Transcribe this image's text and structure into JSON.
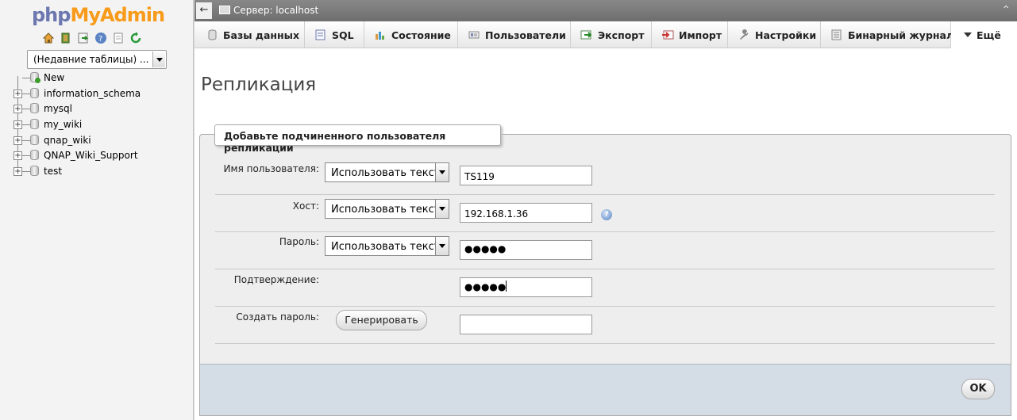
{
  "sidebar": {
    "logo_php": "php",
    "logo_myadmin": "MyAdmin",
    "icons": [
      "home-icon",
      "exit-icon",
      "query-window-icon",
      "help-icon",
      "docs-icon",
      "reload-icon"
    ],
    "recent_tables": "(Недавние таблицы) ...",
    "tree": [
      {
        "label": "New"
      },
      {
        "label": "information_schema"
      },
      {
        "label": "mysql"
      },
      {
        "label": "my_wiki"
      },
      {
        "label": "qnap_wiki"
      },
      {
        "label": "QNAP_Wiki_Support"
      },
      {
        "label": "test"
      }
    ]
  },
  "topbar": {
    "back": "←",
    "server_label": "Сервер: localhost",
    "collapse": "⌃"
  },
  "tabs": [
    {
      "label": "Базы данных",
      "icon": "database-icon"
    },
    {
      "label": "SQL",
      "icon": "sql-icon"
    },
    {
      "label": "Состояние",
      "icon": "status-icon"
    },
    {
      "label": "Пользователи",
      "icon": "users-icon"
    },
    {
      "label": "Экспорт",
      "icon": "export-icon"
    },
    {
      "label": "Импорт",
      "icon": "import-icon"
    },
    {
      "label": "Настройки",
      "icon": "settings-icon"
    },
    {
      "label": "Бинарный журнал",
      "icon": "binlog-icon"
    },
    {
      "label": "Ещё",
      "icon": "more-icon"
    }
  ],
  "main": {
    "title": "Репликация",
    "legend": "Добавьте подчиненного пользователя репликации",
    "fields": {
      "username_label": "Имя пользователя:",
      "username_mode": "Использовать текст",
      "username_value": "TS119",
      "host_label": "Хост:",
      "host_mode": "Использовать текст",
      "host_value": "192.168.1.36",
      "password_label": "Пароль:",
      "password_mode": "Использовать текст",
      "password_value": "●●●●●",
      "confirm_label": "Подтверждение:",
      "confirm_value": "●●●●●",
      "generate_label": "Создать пароль:",
      "generate_button": "Генерировать",
      "generated_value": ""
    },
    "ok_button": "OK"
  }
}
